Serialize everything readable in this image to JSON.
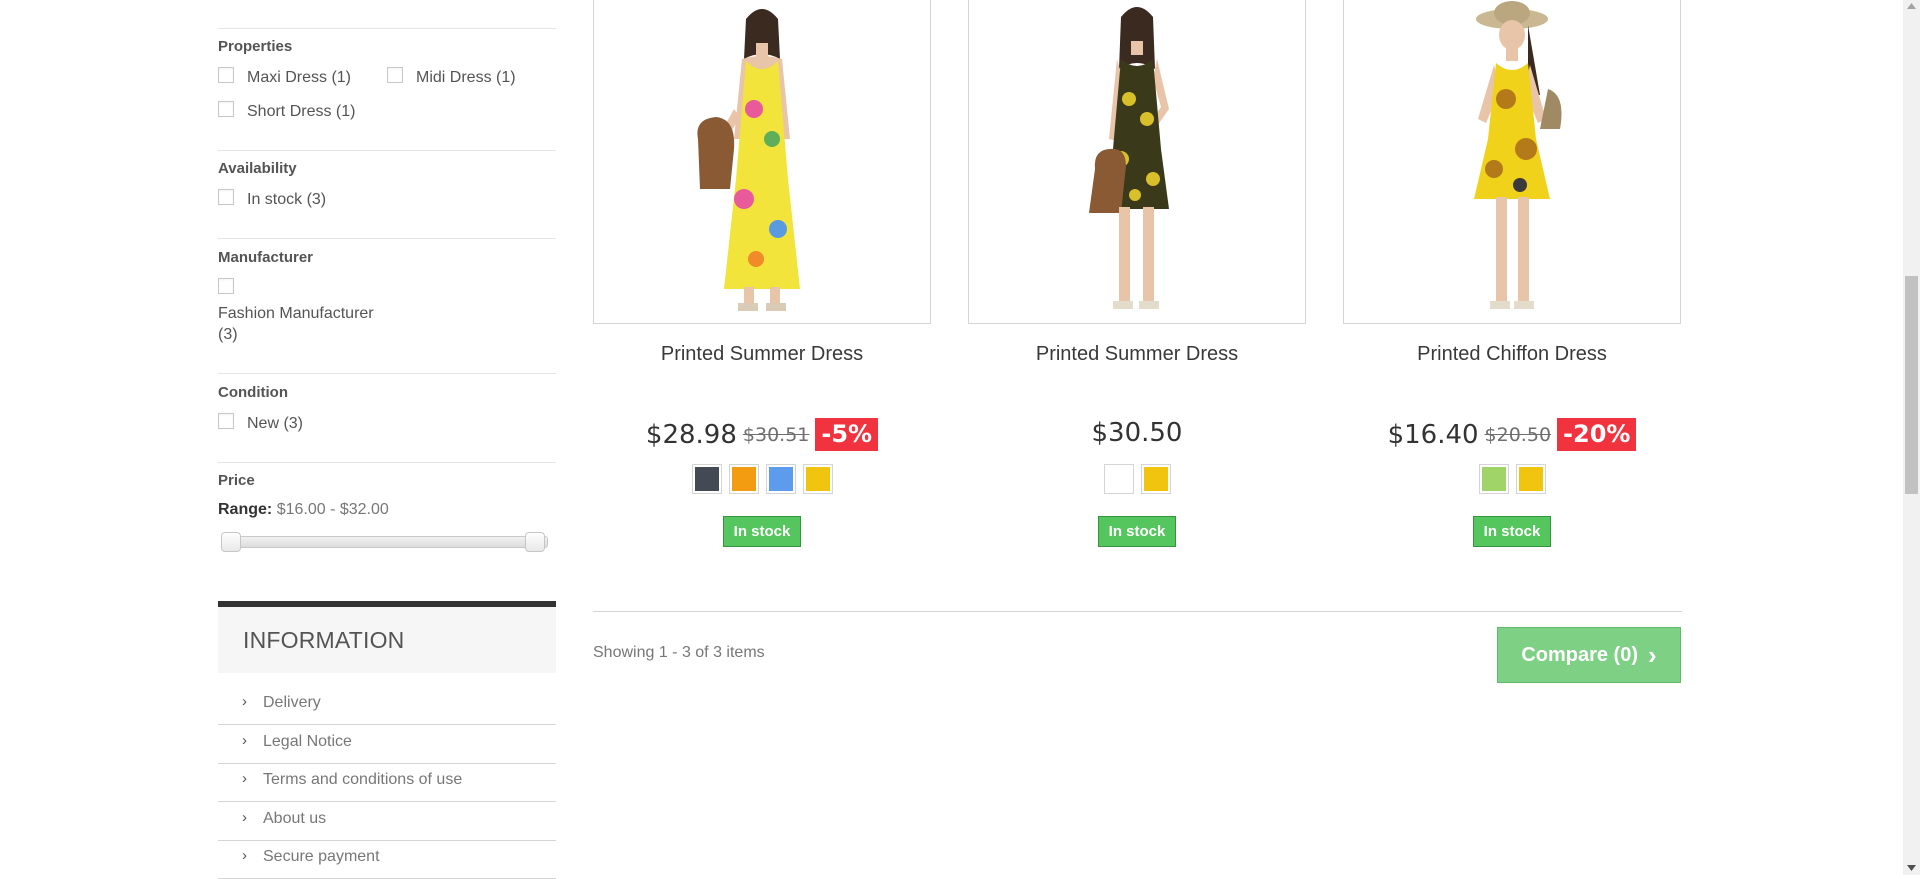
{
  "filters": {
    "properties": {
      "title": "Properties",
      "options": [
        "Maxi Dress (1)",
        "Midi Dress (1)",
        "Short Dress (1)"
      ]
    },
    "availability": {
      "title": "Availability",
      "options": [
        "In stock (3)"
      ]
    },
    "manufacturer": {
      "title": "Manufacturer",
      "option_line1": "Fashion Manufacturer",
      "option_line2": "(3)"
    },
    "condition": {
      "title": "Condition",
      "options": [
        "New (3)"
      ]
    },
    "price": {
      "title": "Price",
      "range_label": "Range:",
      "range_value": "$16.00 - $32.00"
    }
  },
  "information": {
    "title": "INFORMATION",
    "items": [
      "Delivery",
      "Legal Notice",
      "Terms and conditions of use",
      "About us",
      "Secure payment"
    ]
  },
  "products": [
    {
      "name": "Printed Summer Dress",
      "price": "$28.98",
      "old_price": "$30.51",
      "discount": "-5%",
      "colors": [
        "#434a54",
        "#f39c11",
        "#5d9cec",
        "#f1c40f"
      ],
      "stock": "In stock"
    },
    {
      "name": "Printed Summer Dress",
      "price": "$30.50",
      "old_price": "",
      "discount": "",
      "colors": [
        "#ffffff",
        "#f1c40f"
      ],
      "stock": "In stock"
    },
    {
      "name": "Printed Chiffon Dress",
      "price": "$16.40",
      "old_price": "$20.50",
      "discount": "-20%",
      "colors": [
        "#a0d468",
        "#f1c40f"
      ],
      "stock": "In stock"
    }
  ],
  "listing": {
    "showing": "Showing 1 - 3 of 3 items",
    "compare_label": "Compare (0)"
  }
}
